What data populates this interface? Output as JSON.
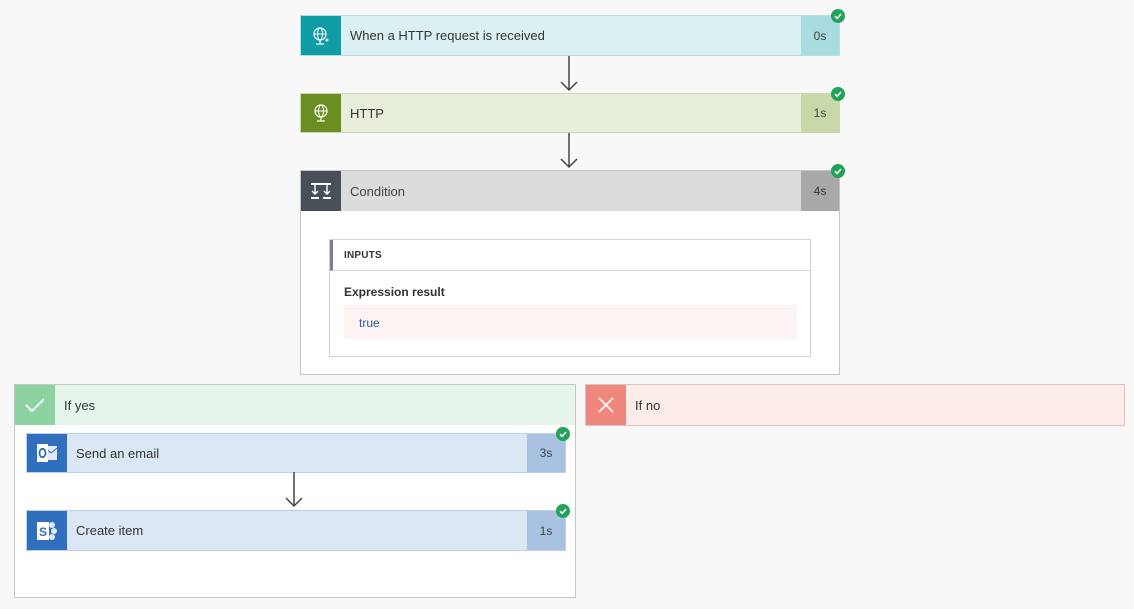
{
  "steps": {
    "http_request": {
      "label": "When a HTTP request is received",
      "duration": "0s",
      "icon": "globe-request-icon"
    },
    "http": {
      "label": "HTTP",
      "duration": "1s",
      "icon": "globe-icon"
    },
    "condition": {
      "label": "Condition",
      "duration": "4s",
      "icon": "condition-icon"
    }
  },
  "condition_details": {
    "section_title": "INPUTS",
    "field_label": "Expression result",
    "field_value": "true"
  },
  "branches": {
    "yes": {
      "label": "If yes",
      "icon": "checkmark-icon",
      "steps": [
        {
          "label": "Send an email",
          "duration": "3s",
          "icon": "outlook-icon"
        },
        {
          "label": "Create item",
          "duration": "1s",
          "icon": "sharepoint-icon"
        }
      ]
    },
    "no": {
      "label": "If no",
      "icon": "close-icon"
    }
  },
  "colors": {
    "request_accent": "#0f9ca5",
    "http_accent": "#6b8e23",
    "condition_accent": "#484f58",
    "office_accent": "#2f6fbd",
    "success": "#22a35a",
    "yes_accent": "#8dd2a1",
    "no_accent": "#f0877e"
  }
}
